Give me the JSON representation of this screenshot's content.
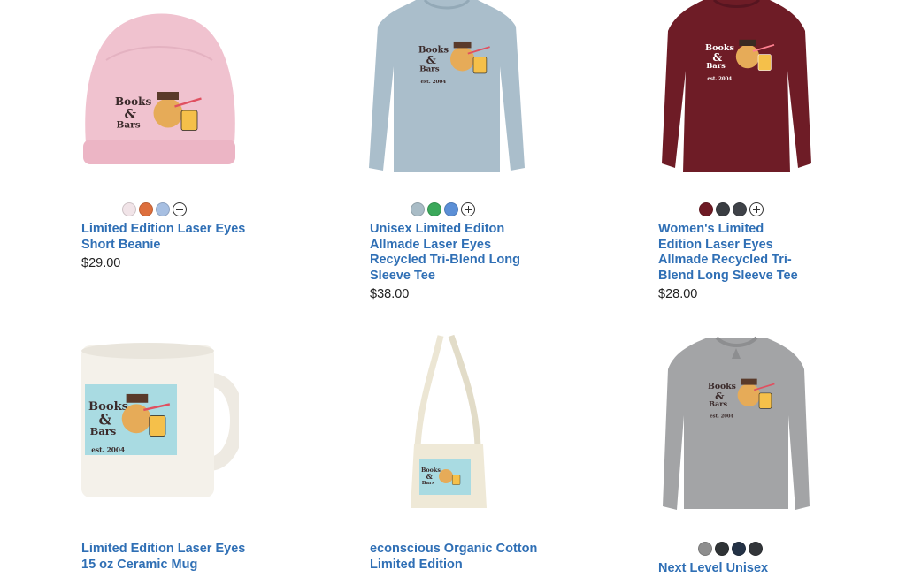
{
  "products": [
    {
      "image": "pink-beanie",
      "swatches": [
        "#f1e4e8",
        "#dd6f3d",
        "#a7bfe2"
      ],
      "title": "Limited Edition Laser Eyes Short Beanie",
      "price": "$29.00"
    },
    {
      "image": "light-blue-long-sleeve-tee",
      "swatches": [
        "#a9bcc6",
        "#3ba85a",
        "#5b8fd6"
      ],
      "title": "Unisex Limited Editon Allmade Laser Eyes Recycled Tri-Blend Long Sleeve Tee",
      "price": "$38.00"
    },
    {
      "image": "maroon-long-sleeve-tee",
      "swatches": [
        "#6e1a24",
        "#3a3d42",
        "#3f4248"
      ],
      "title": "Women's Limited Edition Laser Eyes Allmade Recycled Tri-Blend Long Sleeve Tee",
      "price": "$28.00"
    },
    {
      "image": "ceramic-mug",
      "swatches": [],
      "title": "Limited Edition Laser Eyes 15 oz Ceramic Mug",
      "price": ""
    },
    {
      "image": "organic-cotton-tote",
      "swatches": [],
      "title": "econscious Organic Cotton Limited Edition",
      "price": ""
    },
    {
      "image": "grey-crewneck-sweatshirt",
      "swatches": [
        "#8e8e8e",
        "#2f3336",
        "#243246",
        "#33363a"
      ],
      "title": "Next Level Unisex",
      "price": ""
    }
  ],
  "logo": {
    "line1": "Books",
    "amp": "&",
    "line2": "Bars",
    "est": "est. 2004"
  },
  "more_colors_icon": "plus-circle-icon"
}
